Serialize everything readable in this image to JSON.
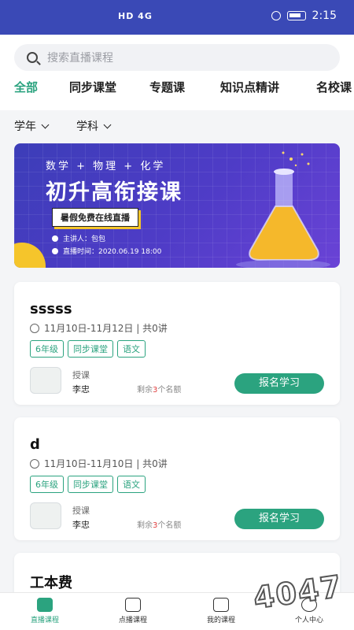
{
  "status": {
    "signal": "HD 4G",
    "time": "2:15"
  },
  "search": {
    "placeholder": "搜索直播课程"
  },
  "tabs": [
    {
      "label": "全部"
    },
    {
      "label": "同步课堂"
    },
    {
      "label": "专题课"
    },
    {
      "label": "知识点精讲"
    },
    {
      "label": "名校课"
    }
  ],
  "filters": {
    "year": "学年",
    "subject": "学科"
  },
  "banner": {
    "subjects": "数学 + 物理 + 化学",
    "title": "初升高衔接课",
    "live": "暑假免费在线直播",
    "lecturer": "主讲人：包包",
    "livetime": "直播时间：2020.06.19 18:00"
  },
  "courses": [
    {
      "title": "sssss",
      "time": "11月10日-11月12日 | 共0讲",
      "tags": [
        "6年级",
        "同步课堂",
        "语文"
      ],
      "teach_label": "授课",
      "teacher": "李忠",
      "remain_pre": "剩余",
      "remain_num": "3",
      "remain_post": "个名额",
      "button": "报名学习"
    },
    {
      "title": "d",
      "time": "11月10日-11月10日 | 共0讲",
      "tags": [
        "6年级",
        "同步课堂",
        "语文"
      ],
      "teach_label": "授课",
      "teacher": "李忠",
      "remain_pre": "剩余",
      "remain_num": "3",
      "remain_post": "个名额",
      "button": "报名学习"
    },
    {
      "title": "工本费"
    }
  ],
  "nav": [
    {
      "label": "直播课程",
      "icon": "video-camera-icon"
    },
    {
      "label": "点播课程",
      "icon": "tv-icon"
    },
    {
      "label": "我的课程",
      "icon": "calendar-icon"
    },
    {
      "label": "个人中心",
      "icon": "user-icon"
    }
  ],
  "watermark": "4047"
}
